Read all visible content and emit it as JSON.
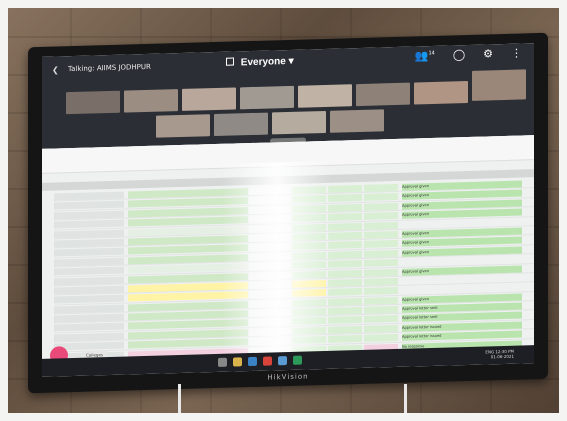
{
  "meeting": {
    "title": "Talking: AIIMS JODHPUR",
    "view_label": "Everyone",
    "participants_count": "14"
  },
  "tv": {
    "brand": "HikVision"
  },
  "sheet": {
    "status_values": [
      "Approval given",
      "Approval letter sent",
      "Approval letter issued",
      "No response",
      "None"
    ],
    "tab_label": "Colleges",
    "rows": [
      {
        "col": "#cfe8c6",
        "status": "Approval given"
      },
      {
        "col": "#cfe8c6",
        "status": "Approval given"
      },
      {
        "col": "#cfe8c6",
        "status": "Approval given"
      },
      {
        "col": "#cfe8c6",
        "status": "Approval given"
      },
      {
        "col": "#e6efe4",
        "status": ""
      },
      {
        "col": "#cfe8c6",
        "status": "Approval given"
      },
      {
        "col": "#cfe8c6",
        "status": "Approval given"
      },
      {
        "col": "#cfe8c6",
        "status": "Approval given"
      },
      {
        "col": "#e6efe4",
        "status": ""
      },
      {
        "col": "#cfe8c6",
        "status": "Approval given"
      },
      {
        "col": "#fff3a6",
        "status": ""
      },
      {
        "col": "#fff3a6",
        "status": ""
      },
      {
        "col": "#cfe8c6",
        "status": "Approval given"
      },
      {
        "col": "#cfe8c6",
        "status": "Approval letter sent"
      },
      {
        "col": "#cfe8c6",
        "status": "Approval letter sent"
      },
      {
        "col": "#cfe8c6",
        "status": "Approval letter issued"
      },
      {
        "col": "#cfe8c6",
        "status": "Approval letter issued"
      },
      {
        "col": "#f3d0e0",
        "status": "No response"
      },
      {
        "col": "#cfe8c6",
        "status": "Approval letter issued"
      }
    ]
  },
  "taskbar": {
    "time": "12:30 PM",
    "date": "01-06-2021",
    "lang": "ENG"
  },
  "colors": {
    "accent_pink": "#e94a7a",
    "yellow": "#fff3a6",
    "green": "#cfe8c6"
  }
}
